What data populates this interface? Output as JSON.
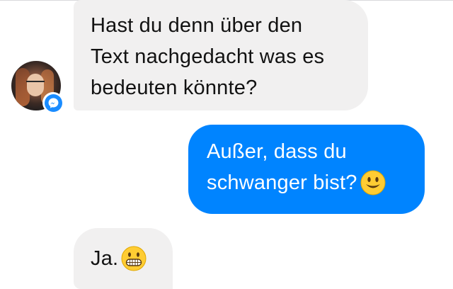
{
  "conversation": {
    "messages": [
      {
        "direction": "incoming",
        "lines": [
          "Hast du denn über den",
          "Text nachgedacht was es",
          "bedeuten könnte?"
        ]
      },
      {
        "direction": "outgoing",
        "lines": [
          "Außer, dass du",
          "schwanger bist?"
        ],
        "emoji": "smiling-face-emoji"
      },
      {
        "direction": "incoming",
        "lines": [
          "Ja."
        ],
        "emoji": "grinning-face-emoji"
      }
    ]
  },
  "contact": {
    "avatar": "contact-avatar",
    "badge_icon": "messenger-icon"
  },
  "colors": {
    "incoming_bubble": "#f1f0f0",
    "outgoing_bubble": "#0084ff",
    "incoming_text": "#121212",
    "outgoing_text": "#ffffff",
    "badge": "#1a8cff",
    "emoji_yellow": "#ffcc33"
  }
}
